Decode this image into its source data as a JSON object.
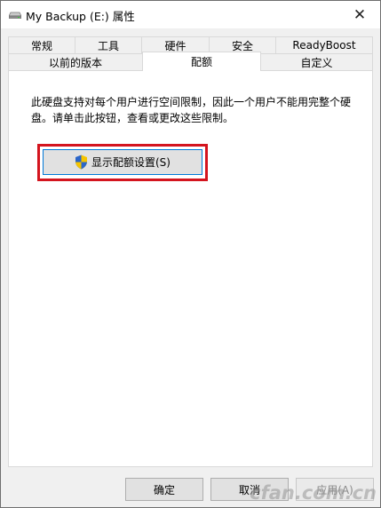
{
  "window": {
    "title": "My Backup (E:) 属性",
    "close_glyph": "✕"
  },
  "tabs_row1": [
    {
      "label": "常规"
    },
    {
      "label": "工具"
    },
    {
      "label": "硬件"
    },
    {
      "label": "安全"
    },
    {
      "label": "ReadyBoost"
    }
  ],
  "tabs_row2": [
    {
      "label": "以前的版本"
    },
    {
      "label": "配额",
      "selected": true
    },
    {
      "label": "自定义"
    }
  ],
  "quota": {
    "description": "此硬盘支持对每个用户进行空间限制，因此一个用户不能用完整个硬盘。请单击此按钮，查看或更改这些限制。",
    "show_settings_label": "显示配额设置(S)"
  },
  "buttons": {
    "ok": "确定",
    "cancel": "取消",
    "apply": "应用(A)"
  },
  "watermark": "cfan.com.cn",
  "colors": {
    "highlight": "#d4141e",
    "focus_border": "#0078d7"
  },
  "icons": {
    "title": "drive-icon",
    "quota_button": "uac-shield-icon"
  }
}
